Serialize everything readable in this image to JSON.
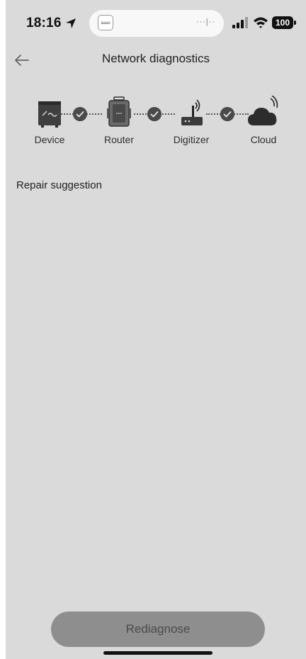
{
  "status_bar": {
    "time": "18:16",
    "island_app_label": "ааан",
    "island_activity": "···|··",
    "battery": "100"
  },
  "header": {
    "title": "Network diagnostics"
  },
  "chain": {
    "nodes": [
      {
        "label": "Device",
        "icon": "inverter-icon"
      },
      {
        "label": "Router",
        "icon": "router-icon"
      },
      {
        "label": "Digitizer",
        "icon": "wifi-router-icon"
      },
      {
        "label": "Cloud",
        "icon": "cloud-icon"
      }
    ],
    "links_status": [
      "ok",
      "ok",
      "ok"
    ]
  },
  "repair": {
    "title": "Repair suggestion"
  },
  "footer": {
    "rediagnose_label": "Rediagnose"
  },
  "colors": {
    "background": "#dadada",
    "button": "#8e8e8e",
    "check": "#4a4a4a"
  }
}
